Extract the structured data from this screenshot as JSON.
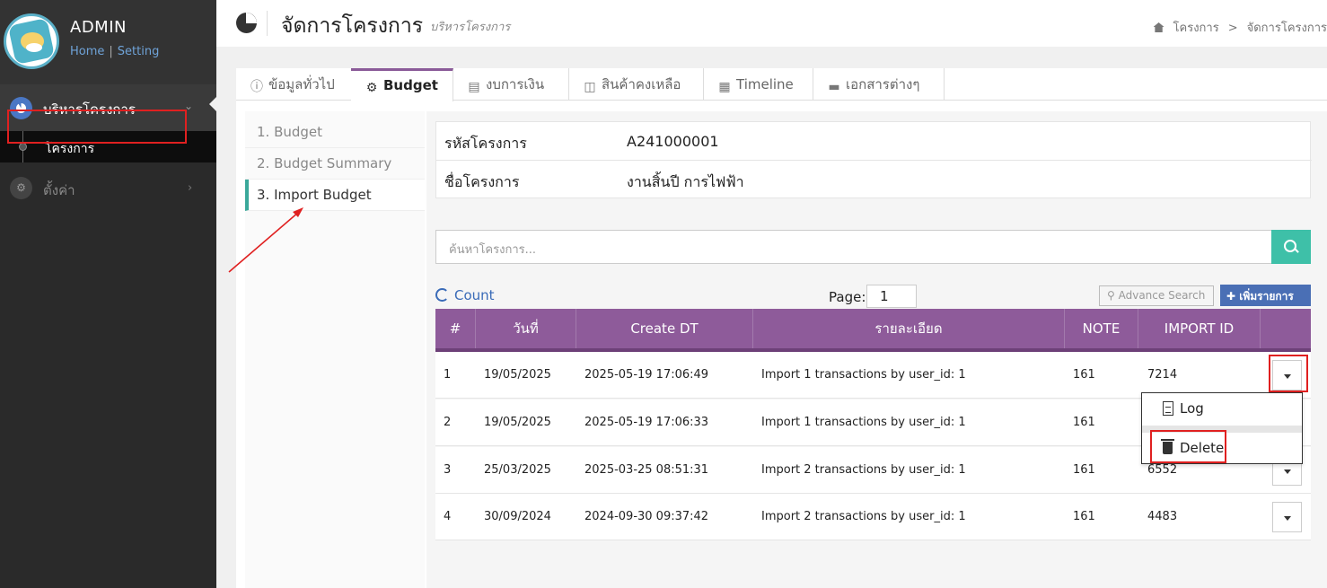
{
  "brand": {
    "title": "ADMIN",
    "home": "Home",
    "sep": "|",
    "setting": "Setting"
  },
  "sidebar": {
    "main": "บริหารโครงการ",
    "sub": "โครงการ",
    "settings": "ตั้งค่า"
  },
  "header": {
    "title": "จัดการโครงการ",
    "subtitle": "บริหารโครงการ",
    "breadcrumb": [
      "โครงการ",
      "จัดการโครงการ"
    ]
  },
  "tabs": [
    {
      "label": "ข้อมูลทั่วไป",
      "icon": "info-icon"
    },
    {
      "label": "Budget",
      "icon": "gear-icon"
    },
    {
      "label": "งบการเงิน",
      "icon": "book-icon"
    },
    {
      "label": "สินค้าคงเหลือ",
      "icon": "cube-icon"
    },
    {
      "label": "Timeline",
      "icon": "calendar-icon"
    },
    {
      "label": "เอกสารต่างๆ",
      "icon": "folder-icon"
    }
  ],
  "left_nav": [
    "1. Budget",
    "2. Budget Summary",
    "3. Import Budget"
  ],
  "project": {
    "code_label": "รหัสโครงการ",
    "code": "A241000001",
    "name_label": "ชื่อโครงการ",
    "name": "งานสิ้นปี การไฟฟ้า"
  },
  "search": {
    "placeholder": "ค้นหาโครงการ..."
  },
  "toolbar": {
    "count": "Count",
    "page_label": "Page:",
    "page": "1",
    "advance": "Advance Search",
    "add": "เพิ่มรายการ"
  },
  "table": {
    "headers": [
      "#",
      "วันที่",
      "Create DT",
      "รายละเอียด",
      "NOTE",
      "IMPORT ID"
    ],
    "rows": [
      {
        "no": "1",
        "date": "19/05/2025",
        "create": "2025-05-19 17:06:49",
        "detail": "Import 1 transactions by user_id: 1",
        "note": "161",
        "import_id": "7214"
      },
      {
        "no": "2",
        "date": "19/05/2025",
        "create": "2025-05-19 17:06:33",
        "detail": "Import 1 transactions by user_id: 1",
        "note": "161",
        "import_id": ""
      },
      {
        "no": "3",
        "date": "25/03/2025",
        "create": "2025-03-25 08:51:31",
        "detail": "Import 2 transactions by user_id: 1",
        "note": "161",
        "import_id": "6552"
      },
      {
        "no": "4",
        "date": "30/09/2024",
        "create": "2024-09-30 09:37:42",
        "detail": "Import 2 transactions by user_id: 1",
        "note": "161",
        "import_id": "4483"
      }
    ]
  },
  "menu": {
    "log": "Log",
    "delete": "Delete"
  },
  "colors": {
    "accent": "#8e5b9a",
    "search_btn": "#3ec0a8",
    "add_btn": "#4a6fb5",
    "annotation": "#e02020"
  }
}
